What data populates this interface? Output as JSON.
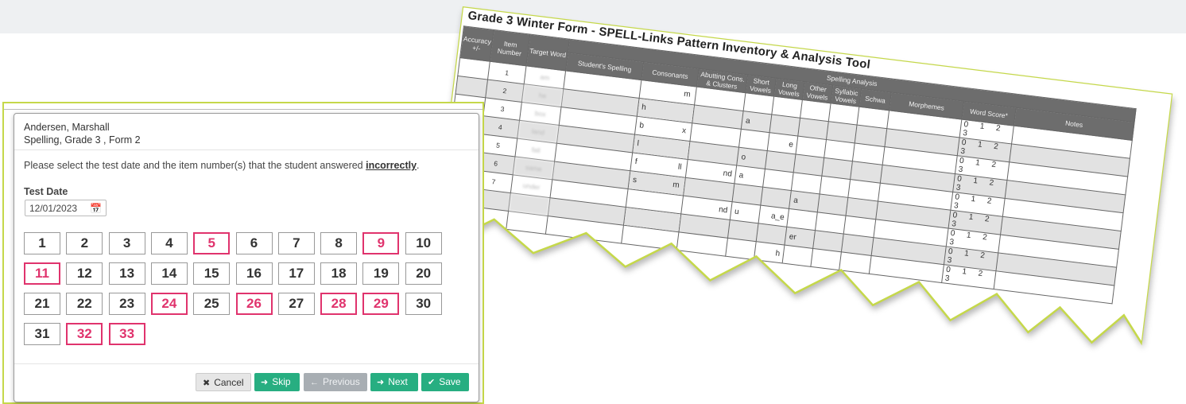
{
  "dialog": {
    "student_name": "Andersen, Marshall",
    "assessment": "Spelling, Grade 3 , Form 2",
    "instruction_prefix": "Please select the test date and the item number(s) that the student answered ",
    "instruction_emphasis": "incorrectly",
    "instruction_suffix": ".",
    "test_date_label": "Test Date",
    "test_date_value": "12/01/2023",
    "items": [
      {
        "n": "1",
        "sel": false
      },
      {
        "n": "2",
        "sel": false
      },
      {
        "n": "3",
        "sel": false
      },
      {
        "n": "4",
        "sel": false
      },
      {
        "n": "5",
        "sel": true
      },
      {
        "n": "6",
        "sel": false
      },
      {
        "n": "7",
        "sel": false
      },
      {
        "n": "8",
        "sel": false
      },
      {
        "n": "9",
        "sel": true
      },
      {
        "n": "10",
        "sel": false
      },
      {
        "n": "11",
        "sel": true
      },
      {
        "n": "12",
        "sel": false
      },
      {
        "n": "13",
        "sel": false
      },
      {
        "n": "14",
        "sel": false
      },
      {
        "n": "15",
        "sel": false
      },
      {
        "n": "16",
        "sel": false
      },
      {
        "n": "17",
        "sel": false
      },
      {
        "n": "18",
        "sel": false
      },
      {
        "n": "19",
        "sel": false
      },
      {
        "n": "20",
        "sel": false
      },
      {
        "n": "21",
        "sel": false
      },
      {
        "n": "22",
        "sel": false
      },
      {
        "n": "23",
        "sel": false
      },
      {
        "n": "24",
        "sel": true
      },
      {
        "n": "25",
        "sel": false
      },
      {
        "n": "26",
        "sel": true
      },
      {
        "n": "27",
        "sel": false
      },
      {
        "n": "28",
        "sel": true
      },
      {
        "n": "29",
        "sel": true
      },
      {
        "n": "30",
        "sel": false
      },
      {
        "n": "31",
        "sel": false
      },
      {
        "n": "32",
        "sel": true
      },
      {
        "n": "33",
        "sel": true
      }
    ],
    "buttons": {
      "cancel": "Cancel",
      "skip": "Skip",
      "previous": "Previous",
      "next": "Next",
      "save": "Save"
    }
  },
  "form": {
    "title": "Grade 3 Winter Form - SPELL-Links Pattern Inventory & Analysis Tool",
    "headers": {
      "accuracy": "Accuracy +/-",
      "item_number": "Item Number",
      "target_word": "Target Word",
      "spelling_analysis": "Spelling Analysis",
      "students_spelling": "Student's Spelling",
      "consonants": "Consonants",
      "abutting": "Abutting Cons. & Clusters",
      "short_vowels": "Short Vowels",
      "long_vowels": "Long Vowels",
      "other_vowels": "Other Vowels",
      "syllabic_vowels": "Syllabic Vowels",
      "schwa": "Schwa",
      "morphemes": "Morphemes",
      "word_score": "Word Score*",
      "notes": "Notes"
    },
    "word_score_scale": "0 1 2 3",
    "rows": [
      {
        "item": "1",
        "target": "am",
        "cons_l": "",
        "cons_r": "m",
        "abut": "",
        "short": "",
        "long": "",
        "other": ""
      },
      {
        "item": "2",
        "target": "he",
        "cons_l": "h",
        "cons_r": "",
        "abut": "",
        "short": "a",
        "long": "",
        "other": ""
      },
      {
        "item": "3",
        "target": "box",
        "cons_l": "b",
        "cons_r": "x",
        "abut": "",
        "short": "",
        "long": "e",
        "other": ""
      },
      {
        "item": "4",
        "target": "land",
        "cons_l": "l",
        "cons_r": "",
        "abut": "",
        "short": "o",
        "long": "",
        "other": ""
      },
      {
        "item": "5",
        "target": "fall",
        "cons_l": "f",
        "cons_r": "ll",
        "abut": "nd",
        "short": "a",
        "long": "",
        "other": ""
      },
      {
        "item": "6",
        "target": "same",
        "cons_l": "s",
        "cons_r": "m",
        "abut": "",
        "short": "",
        "long": "",
        "other": "a"
      },
      {
        "item": "7",
        "target": "under",
        "cons_l": "",
        "cons_r": "",
        "abut": "nd",
        "short": "u",
        "long": "a_e",
        "other": ""
      },
      {
        "item": "",
        "target": "",
        "cons_l": "",
        "cons_r": "",
        "abut": "",
        "short": "",
        "long": "",
        "other": "er"
      },
      {
        "item": "",
        "target": "",
        "cons_l": "",
        "cons_r": "",
        "abut": "",
        "short": "",
        "long": "h",
        "other": ""
      }
    ]
  }
}
